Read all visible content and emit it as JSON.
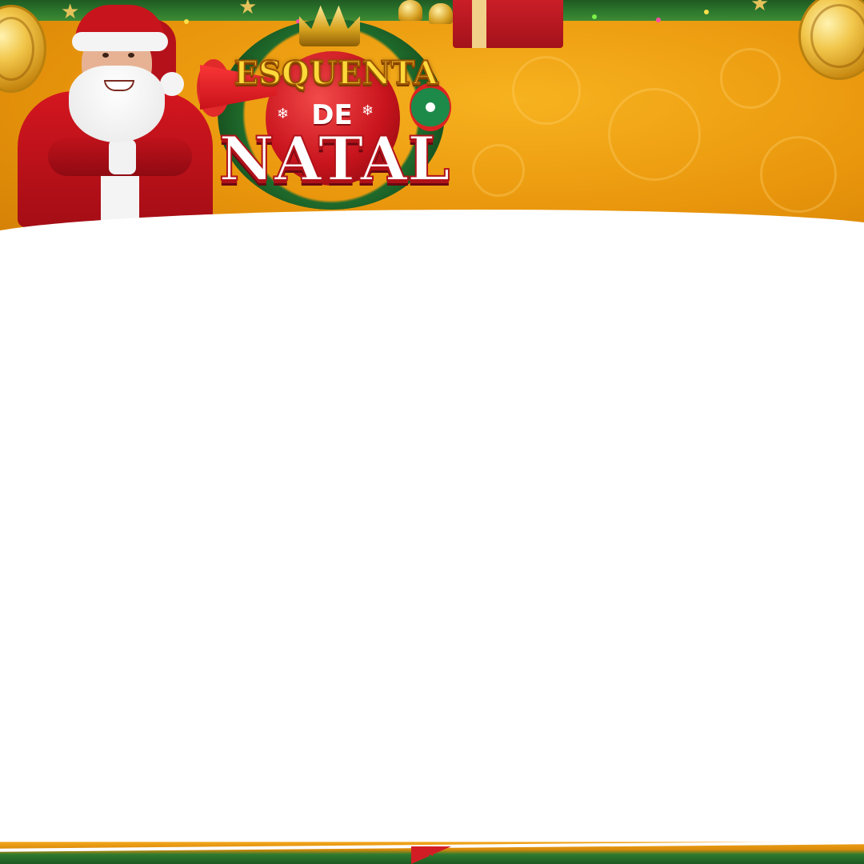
{
  "banner": {
    "logo": {
      "line1": "ESQUENTA",
      "line2": "DE",
      "line3": "NATAL"
    },
    "colors": {
      "background": "#f0a516",
      "brand_red": "#c9141d",
      "brand_gold": "#ffd83a",
      "garland_green": "#2e7a2e"
    },
    "decorations": [
      "santa-claus",
      "gold-coin",
      "gift-box",
      "bells",
      "stars",
      "string-lights",
      "megaphone-icon",
      "christmas-ornament"
    ]
  }
}
